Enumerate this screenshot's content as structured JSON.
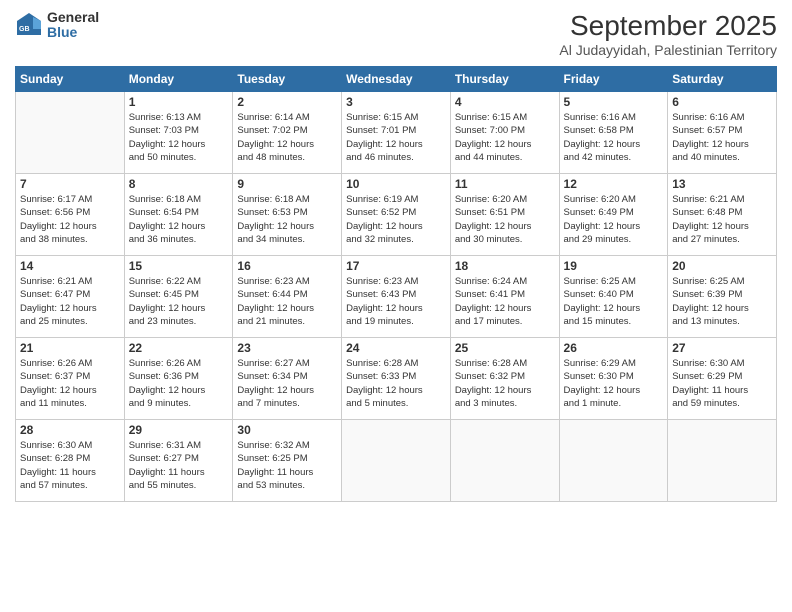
{
  "header": {
    "logo_general": "General",
    "logo_blue": "Blue",
    "month_title": "September 2025",
    "subtitle": "Al Judayyidah, Palestinian Territory"
  },
  "days_of_week": [
    "Sunday",
    "Monday",
    "Tuesday",
    "Wednesday",
    "Thursday",
    "Friday",
    "Saturday"
  ],
  "weeks": [
    [
      {
        "day": "",
        "info": ""
      },
      {
        "day": "1",
        "info": "Sunrise: 6:13 AM\nSunset: 7:03 PM\nDaylight: 12 hours\nand 50 minutes."
      },
      {
        "day": "2",
        "info": "Sunrise: 6:14 AM\nSunset: 7:02 PM\nDaylight: 12 hours\nand 48 minutes."
      },
      {
        "day": "3",
        "info": "Sunrise: 6:15 AM\nSunset: 7:01 PM\nDaylight: 12 hours\nand 46 minutes."
      },
      {
        "day": "4",
        "info": "Sunrise: 6:15 AM\nSunset: 7:00 PM\nDaylight: 12 hours\nand 44 minutes."
      },
      {
        "day": "5",
        "info": "Sunrise: 6:16 AM\nSunset: 6:58 PM\nDaylight: 12 hours\nand 42 minutes."
      },
      {
        "day": "6",
        "info": "Sunrise: 6:16 AM\nSunset: 6:57 PM\nDaylight: 12 hours\nand 40 minutes."
      }
    ],
    [
      {
        "day": "7",
        "info": "Sunrise: 6:17 AM\nSunset: 6:56 PM\nDaylight: 12 hours\nand 38 minutes."
      },
      {
        "day": "8",
        "info": "Sunrise: 6:18 AM\nSunset: 6:54 PM\nDaylight: 12 hours\nand 36 minutes."
      },
      {
        "day": "9",
        "info": "Sunrise: 6:18 AM\nSunset: 6:53 PM\nDaylight: 12 hours\nand 34 minutes."
      },
      {
        "day": "10",
        "info": "Sunrise: 6:19 AM\nSunset: 6:52 PM\nDaylight: 12 hours\nand 32 minutes."
      },
      {
        "day": "11",
        "info": "Sunrise: 6:20 AM\nSunset: 6:51 PM\nDaylight: 12 hours\nand 30 minutes."
      },
      {
        "day": "12",
        "info": "Sunrise: 6:20 AM\nSunset: 6:49 PM\nDaylight: 12 hours\nand 29 minutes."
      },
      {
        "day": "13",
        "info": "Sunrise: 6:21 AM\nSunset: 6:48 PM\nDaylight: 12 hours\nand 27 minutes."
      }
    ],
    [
      {
        "day": "14",
        "info": "Sunrise: 6:21 AM\nSunset: 6:47 PM\nDaylight: 12 hours\nand 25 minutes."
      },
      {
        "day": "15",
        "info": "Sunrise: 6:22 AM\nSunset: 6:45 PM\nDaylight: 12 hours\nand 23 minutes."
      },
      {
        "day": "16",
        "info": "Sunrise: 6:23 AM\nSunset: 6:44 PM\nDaylight: 12 hours\nand 21 minutes."
      },
      {
        "day": "17",
        "info": "Sunrise: 6:23 AM\nSunset: 6:43 PM\nDaylight: 12 hours\nand 19 minutes."
      },
      {
        "day": "18",
        "info": "Sunrise: 6:24 AM\nSunset: 6:41 PM\nDaylight: 12 hours\nand 17 minutes."
      },
      {
        "day": "19",
        "info": "Sunrise: 6:25 AM\nSunset: 6:40 PM\nDaylight: 12 hours\nand 15 minutes."
      },
      {
        "day": "20",
        "info": "Sunrise: 6:25 AM\nSunset: 6:39 PM\nDaylight: 12 hours\nand 13 minutes."
      }
    ],
    [
      {
        "day": "21",
        "info": "Sunrise: 6:26 AM\nSunset: 6:37 PM\nDaylight: 12 hours\nand 11 minutes."
      },
      {
        "day": "22",
        "info": "Sunrise: 6:26 AM\nSunset: 6:36 PM\nDaylight: 12 hours\nand 9 minutes."
      },
      {
        "day": "23",
        "info": "Sunrise: 6:27 AM\nSunset: 6:34 PM\nDaylight: 12 hours\nand 7 minutes."
      },
      {
        "day": "24",
        "info": "Sunrise: 6:28 AM\nSunset: 6:33 PM\nDaylight: 12 hours\nand 5 minutes."
      },
      {
        "day": "25",
        "info": "Sunrise: 6:28 AM\nSunset: 6:32 PM\nDaylight: 12 hours\nand 3 minutes."
      },
      {
        "day": "26",
        "info": "Sunrise: 6:29 AM\nSunset: 6:30 PM\nDaylight: 12 hours\nand 1 minute."
      },
      {
        "day": "27",
        "info": "Sunrise: 6:30 AM\nSunset: 6:29 PM\nDaylight: 11 hours\nand 59 minutes."
      }
    ],
    [
      {
        "day": "28",
        "info": "Sunrise: 6:30 AM\nSunset: 6:28 PM\nDaylight: 11 hours\nand 57 minutes."
      },
      {
        "day": "29",
        "info": "Sunrise: 6:31 AM\nSunset: 6:27 PM\nDaylight: 11 hours\nand 55 minutes."
      },
      {
        "day": "30",
        "info": "Sunrise: 6:32 AM\nSunset: 6:25 PM\nDaylight: 11 hours\nand 53 minutes."
      },
      {
        "day": "",
        "info": ""
      },
      {
        "day": "",
        "info": ""
      },
      {
        "day": "",
        "info": ""
      },
      {
        "day": "",
        "info": ""
      }
    ]
  ]
}
